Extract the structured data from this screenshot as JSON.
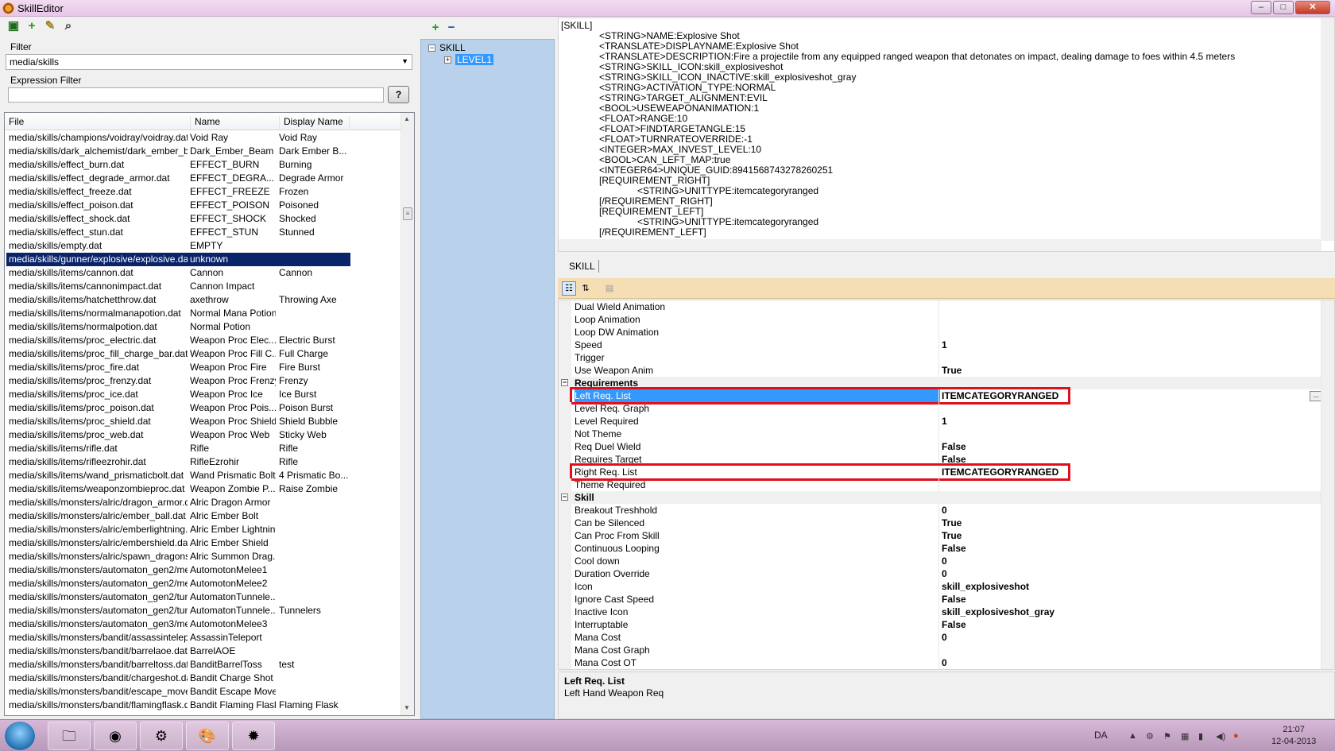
{
  "window": {
    "title": "SkillEditor",
    "min_label": "–",
    "max_label": "□",
    "close_label": "✕"
  },
  "toolbar_left": [
    {
      "name": "save-icon",
      "glyph": "▣",
      "color": "#1a6a1a"
    },
    {
      "name": "add-icon",
      "glyph": "+",
      "color": "#1a9a1a"
    },
    {
      "name": "edit-icon",
      "glyph": "✎",
      "color": "#a08020"
    },
    {
      "name": "search-icon",
      "glyph": "⌕",
      "color": "#334"
    }
  ],
  "filter": {
    "label": "Filter",
    "value": "media/skills",
    "arrow": "▼"
  },
  "expression_filter": {
    "label": "Expression Filter",
    "value": "",
    "button": "?"
  },
  "file_list": {
    "columns": [
      "File",
      "Name",
      "Display Name"
    ],
    "rows": [
      {
        "file": "media/skills/champions/voidray/voidray.dat",
        "name": "Void Ray",
        "display": "Void Ray"
      },
      {
        "file": "media/skills/dark_alchemist/dark_ember_be...",
        "name": "Dark_Ember_Beam",
        "display": "Dark Ember B..."
      },
      {
        "file": "media/skills/effect_burn.dat",
        "name": "EFFECT_BURN",
        "display": "Burning"
      },
      {
        "file": "media/skills/effect_degrade_armor.dat",
        "name": "EFFECT_DEGRA...",
        "display": "Degrade Armor"
      },
      {
        "file": "media/skills/effect_freeze.dat",
        "name": "EFFECT_FREEZE",
        "display": "Frozen"
      },
      {
        "file": "media/skills/effect_poison.dat",
        "name": "EFFECT_POISON",
        "display": "Poisoned"
      },
      {
        "file": "media/skills/effect_shock.dat",
        "name": "EFFECT_SHOCK",
        "display": "Shocked"
      },
      {
        "file": "media/skills/effect_stun.dat",
        "name": "EFFECT_STUN",
        "display": "Stunned"
      },
      {
        "file": "media/skills/empty.dat",
        "name": "EMPTY",
        "display": ""
      },
      {
        "file": "media/skills/gunner/explosive/explosive.dat",
        "name": "unknown",
        "display": "",
        "selected": true
      },
      {
        "file": "media/skills/items/cannon.dat",
        "name": "Cannon",
        "display": "Cannon"
      },
      {
        "file": "media/skills/items/cannonimpact.dat",
        "name": "Cannon Impact",
        "display": ""
      },
      {
        "file": "media/skills/items/hatchetthrow.dat",
        "name": "axethrow",
        "display": "Throwing Axe"
      },
      {
        "file": "media/skills/items/normalmanapotion.dat",
        "name": "Normal Mana Potion",
        "display": ""
      },
      {
        "file": "media/skills/items/normalpotion.dat",
        "name": "Normal Potion",
        "display": ""
      },
      {
        "file": "media/skills/items/proc_electric.dat",
        "name": "Weapon Proc Elec...",
        "display": "Electric Burst"
      },
      {
        "file": "media/skills/items/proc_fill_charge_bar.dat",
        "name": "Weapon Proc Fill C...",
        "display": "Full Charge"
      },
      {
        "file": "media/skills/items/proc_fire.dat",
        "name": "Weapon Proc Fire",
        "display": "Fire Burst"
      },
      {
        "file": "media/skills/items/proc_frenzy.dat",
        "name": "Weapon Proc Frenzy",
        "display": "Frenzy"
      },
      {
        "file": "media/skills/items/proc_ice.dat",
        "name": "Weapon Proc Ice",
        "display": "Ice Burst"
      },
      {
        "file": "media/skills/items/proc_poison.dat",
        "name": "Weapon Proc Pois...",
        "display": "Poison Burst"
      },
      {
        "file": "media/skills/items/proc_shield.dat",
        "name": "Weapon Proc Shield",
        "display": "Shield Bubble"
      },
      {
        "file": "media/skills/items/proc_web.dat",
        "name": "Weapon Proc Web",
        "display": "Sticky Web"
      },
      {
        "file": "media/skills/items/rifle.dat",
        "name": "Rifle",
        "display": "Rifle"
      },
      {
        "file": "media/skills/items/rifleezrohir.dat",
        "name": "RifleEzrohir",
        "display": "Rifle"
      },
      {
        "file": "media/skills/items/wand_prismaticbolt.dat",
        "name": "Wand Prismatic Bolt",
        "display": "4 Prismatic Bo..."
      },
      {
        "file": "media/skills/items/weaponzombieproc.dat",
        "name": "Weapon Zombie P...",
        "display": "Raise Zombie"
      },
      {
        "file": "media/skills/monsters/alric/dragon_armor.dat",
        "name": "Alric Dragon Armor",
        "display": ""
      },
      {
        "file": "media/skills/monsters/alric/ember_ball.dat",
        "name": "Alric Ember Bolt",
        "display": ""
      },
      {
        "file": "media/skills/monsters/alric/emberlightning.dat",
        "name": "Alric Ember Lightning",
        "display": ""
      },
      {
        "file": "media/skills/monsters/alric/embershield.dat",
        "name": "Alric Ember Shield",
        "display": ""
      },
      {
        "file": "media/skills/monsters/alric/spawn_dragons....",
        "name": "Alric Summon Drag...",
        "display": ""
      },
      {
        "file": "media/skills/monsters/automaton_gen2/mel...",
        "name": "AutomotonMelee1",
        "display": ""
      },
      {
        "file": "media/skills/monsters/automaton_gen2/mel...",
        "name": "AutomotonMelee2",
        "display": ""
      },
      {
        "file": "media/skills/monsters/automaton_gen2/tun...",
        "name": "AutomatonTunnele...",
        "display": ""
      },
      {
        "file": "media/skills/monsters/automaton_gen2/tun...",
        "name": "AutomatonTunnele...",
        "display": "Tunnelers"
      },
      {
        "file": "media/skills/monsters/automaton_gen3/mel...",
        "name": "AutomotonMelee3",
        "display": ""
      },
      {
        "file": "media/skills/monsters/bandit/assassintelepo...",
        "name": "AssassinTeleport",
        "display": ""
      },
      {
        "file": "media/skills/monsters/bandit/barrelaoe.dat",
        "name": "BarrelAOE",
        "display": ""
      },
      {
        "file": "media/skills/monsters/bandit/barreltoss.dat",
        "name": "BanditBarrelToss",
        "display": "test"
      },
      {
        "file": "media/skills/monsters/bandit/chargeshot.dat",
        "name": "Bandit Charge Shot",
        "display": ""
      },
      {
        "file": "media/skills/monsters/bandit/escape_move....",
        "name": "Bandit Escape Move",
        "display": ""
      },
      {
        "file": "media/skills/monsters/bandit/flamingflask.dat",
        "name": "Bandit Flaming Flask",
        "display": "Flaming Flask"
      }
    ]
  },
  "tree": {
    "root": "SKILL",
    "child": "LEVEL1",
    "root_toggle": "−",
    "child_toggle": "+"
  },
  "mid_toolbar": {
    "add": "+",
    "remove": "−"
  },
  "script": [
    {
      "text": "[SKILL]",
      "indent": 0
    },
    {
      "text": "<STRING>NAME:Explosive Shot",
      "indent": 1
    },
    {
      "text": "<TRANSLATE>DISPLAYNAME:Explosive Shot",
      "indent": 1
    },
    {
      "text": "<TRANSLATE>DESCRIPTION:Fire a projectile from any equipped ranged weapon that detonates on impact, dealing damage to foes within 4.5 meters",
      "indent": 1
    },
    {
      "text": "<STRING>SKILL_ICON:skill_explosiveshot",
      "indent": 1
    },
    {
      "text": "<STRING>SKILL_ICON_INACTIVE:skill_explosiveshot_gray",
      "indent": 1
    },
    {
      "text": "<STRING>ACTIVATION_TYPE:NORMAL",
      "indent": 1
    },
    {
      "text": "<STRING>TARGET_ALIGNMENT:EVIL",
      "indent": 1
    },
    {
      "text": "<BOOL>USEWEAPONANIMATION:1",
      "indent": 1
    },
    {
      "text": "<FLOAT>RANGE:10",
      "indent": 1
    },
    {
      "text": "<FLOAT>FINDTARGETANGLE:15",
      "indent": 1
    },
    {
      "text": "<FLOAT>TURNRATEOVERRIDE:-1",
      "indent": 1
    },
    {
      "text": "<INTEGER>MAX_INVEST_LEVEL:10",
      "indent": 1
    },
    {
      "text": "<BOOL>CAN_LEFT_MAP:true",
      "indent": 1
    },
    {
      "text": "<INTEGER64>UNIQUE_GUID:8941568743278260251",
      "indent": 1
    },
    {
      "text": "[REQUIREMENT_RIGHT]",
      "indent": 1
    },
    {
      "text": "<STRING>UNITTYPE:itemcategoryranged",
      "indent": 2
    },
    {
      "text": "[/REQUIREMENT_RIGHT]",
      "indent": 1
    },
    {
      "text": "[REQUIREMENT_LEFT]",
      "indent": 1
    },
    {
      "text": "<STRING>UNITTYPE:itemcategoryranged",
      "indent": 2
    },
    {
      "text": "[/REQUIREMENT_LEFT]",
      "indent": 1
    }
  ],
  "tab": {
    "label": "SKILL"
  },
  "grid_toolbar": [
    {
      "name": "categorized-icon",
      "glyph": "☷"
    },
    {
      "name": "alphabetical-icon",
      "glyph": "⇅"
    },
    {
      "name": "property-pages-icon",
      "glyph": "▤"
    }
  ],
  "properties": [
    {
      "type": "prop",
      "name": "Dual Wield Animation",
      "value": ""
    },
    {
      "type": "prop",
      "name": "Loop Animation",
      "value": ""
    },
    {
      "type": "prop",
      "name": "Loop DW Animation",
      "value": ""
    },
    {
      "type": "prop",
      "name": "Speed",
      "value": "1"
    },
    {
      "type": "prop",
      "name": "Trigger",
      "value": ""
    },
    {
      "type": "prop",
      "name": "Use Weapon Anim",
      "value": "True"
    },
    {
      "type": "cat",
      "name": "Requirements",
      "toggle": "−"
    },
    {
      "type": "prop",
      "name": "Left Req. List",
      "value": "ITEMCATEGORYRANGED",
      "selected": true,
      "highlight": true,
      "dots": "..."
    },
    {
      "type": "prop",
      "name": "Level Req. Graph",
      "value": ""
    },
    {
      "type": "prop",
      "name": "Level Required",
      "value": "1"
    },
    {
      "type": "prop",
      "name": "Not Theme",
      "value": ""
    },
    {
      "type": "prop",
      "name": "Req Duel Wield",
      "value": "False"
    },
    {
      "type": "prop",
      "name": "Requires Target",
      "value": "False"
    },
    {
      "type": "prop",
      "name": "Right Req. List",
      "value": "ITEMCATEGORYRANGED",
      "highlight": true
    },
    {
      "type": "prop",
      "name": "Theme Required",
      "value": ""
    },
    {
      "type": "cat",
      "name": "Skill",
      "toggle": "−"
    },
    {
      "type": "prop",
      "name": "Breakout Treshhold",
      "value": "0"
    },
    {
      "type": "prop",
      "name": "Can be Silenced",
      "value": "True"
    },
    {
      "type": "prop",
      "name": "Can Proc From Skill",
      "value": "True"
    },
    {
      "type": "prop",
      "name": "Continuous Looping",
      "value": "False"
    },
    {
      "type": "prop",
      "name": "Cool down",
      "value": "0"
    },
    {
      "type": "prop",
      "name": "Duration Override",
      "value": "0"
    },
    {
      "type": "prop",
      "name": "Icon",
      "value": "skill_explosiveshot"
    },
    {
      "type": "prop",
      "name": "Ignore Cast Speed",
      "value": "False"
    },
    {
      "type": "prop",
      "name": "Inactive Icon",
      "value": "skill_explosiveshot_gray"
    },
    {
      "type": "prop",
      "name": "Interruptable",
      "value": "False"
    },
    {
      "type": "prop",
      "name": "Mana Cost",
      "value": "0"
    },
    {
      "type": "prop",
      "name": "Mana Cost Graph",
      "value": ""
    },
    {
      "type": "prop",
      "name": "Mana Cost OT",
      "value": "0"
    }
  ],
  "help": {
    "title": "Left Req. List",
    "description": "Left Hand Weapon Req"
  },
  "taskbar": {
    "apps": [
      {
        "name": "explorer-icon",
        "glyph": "🗀"
      },
      {
        "name": "chrome-icon",
        "glyph": "◉"
      },
      {
        "name": "steam-icon",
        "glyph": "⚙"
      },
      {
        "name": "paint-icon",
        "glyph": "🎨"
      },
      {
        "name": "skilleditor-icon",
        "glyph": "✹"
      }
    ],
    "language": "DA",
    "time": "21:07",
    "date": "12-04-2013"
  },
  "colors": {
    "highlight_red": "#e0101a",
    "selection_blue": "#3399ff",
    "list_selection": "#0a246a"
  }
}
